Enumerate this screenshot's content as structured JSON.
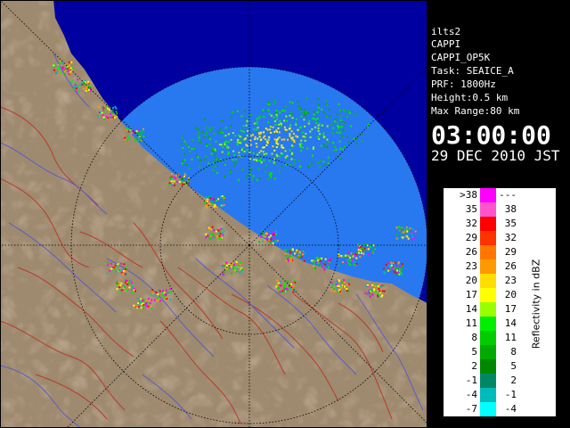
{
  "info": {
    "lines": [
      "ilts2",
      "CAPPI",
      "CAPPI_OP5K",
      "Task: SEAICE_A",
      "PRF: 1800Hz",
      "Height:0.5 km",
      "Max Range:80 km"
    ],
    "time": "03:00:00",
    "date": "29 DEC 2010 JST"
  },
  "legend": {
    "title": "Reflectivity in dBZ",
    "rows": [
      {
        "lo": ">38",
        "hi": "---",
        "color": "#ff00ff"
      },
      {
        "lo": "35",
        "hi": "38",
        "color": "#ff55cc"
      },
      {
        "lo": "32",
        "hi": "35",
        "color": "#ff0000"
      },
      {
        "lo": "29",
        "hi": "32",
        "color": "#ff3300"
      },
      {
        "lo": "26",
        "hi": "29",
        "color": "#ff7700"
      },
      {
        "lo": "23",
        "hi": "26",
        "color": "#ff9900"
      },
      {
        "lo": "20",
        "hi": "23",
        "color": "#ffdd00"
      },
      {
        "lo": "17",
        "hi": "20",
        "color": "#ffff00"
      },
      {
        "lo": "14",
        "hi": "17",
        "color": "#99ff00"
      },
      {
        "lo": "11",
        "hi": "14",
        "color": "#00ee00"
      },
      {
        "lo": "8",
        "hi": "11",
        "color": "#00cc00"
      },
      {
        "lo": "5",
        "hi": "8",
        "color": "#00aa00"
      },
      {
        "lo": "2",
        "hi": "5",
        "color": "#008800"
      },
      {
        "lo": "-1",
        "hi": "2",
        "color": "#008866"
      },
      {
        "lo": "-4",
        "hi": "-1",
        "color": "#00bbbb"
      },
      {
        "lo": "-7",
        "hi": "-4",
        "color": "#00ffff"
      }
    ]
  },
  "colors": {
    "sea_outside_range": "#0000a0",
    "sea_in_range": "#2878f0",
    "land_base": "#8c7458",
    "river_red": "#b83a2a",
    "river_blue": "#5a5ad0",
    "grid": "#000000"
  }
}
